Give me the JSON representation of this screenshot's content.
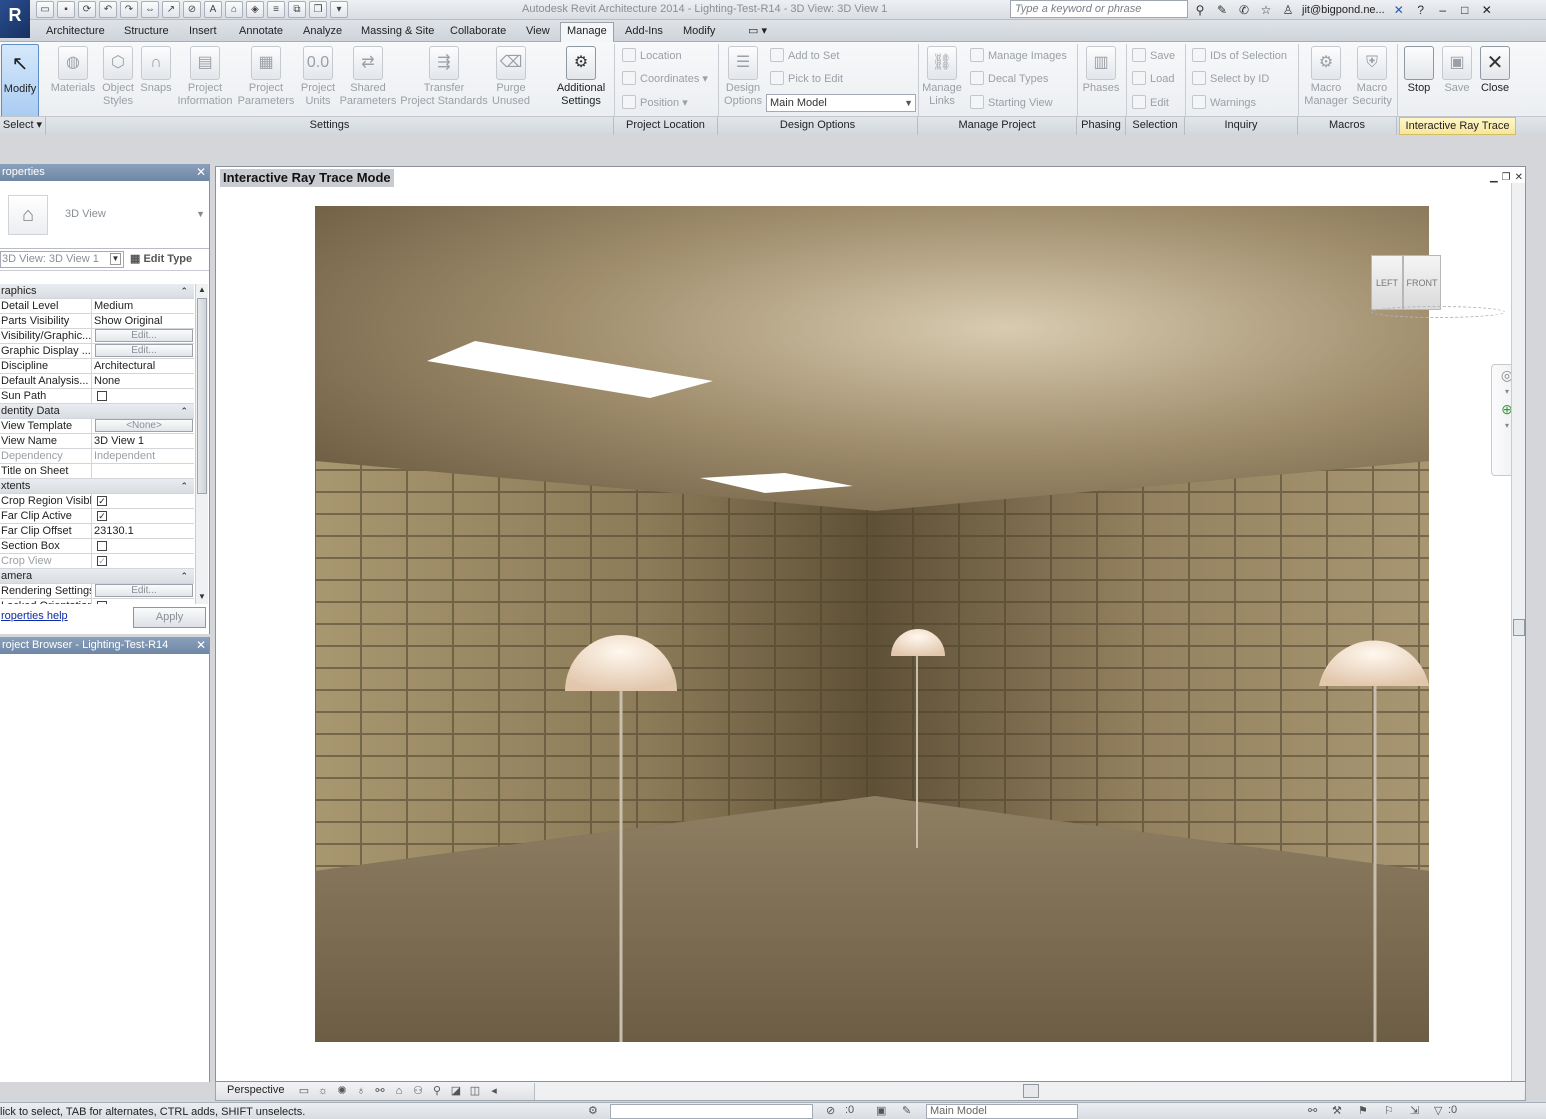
{
  "titlebar": {
    "title": "Autodesk Revit Architecture 2014 -    Lighting-Test-R14 - 3D View: 3D View 1",
    "search_placeholder": "Type a keyword or phrase",
    "user": "jit@bigpond.ne..."
  },
  "tabs": [
    "Architecture",
    "Structure",
    "Insert",
    "Annotate",
    "Analyze",
    "Massing & Site",
    "Collaborate",
    "View",
    "Manage",
    "Add-Ins",
    "Modify"
  ],
  "active_tab": "Manage",
  "ribbon": {
    "modify": "Modify",
    "select": "Select",
    "settings_buttons": [
      {
        "l1": "Materials",
        "l2": ""
      },
      {
        "l1": "Object",
        "l2": "Styles"
      },
      {
        "l1": "Snaps",
        "l2": ""
      },
      {
        "l1": "Project",
        "l2": "Information"
      },
      {
        "l1": "Project",
        "l2": "Parameters"
      },
      {
        "l1": "Project",
        "l2": "Units"
      },
      {
        "l1": "Shared",
        "l2": "Parameters"
      },
      {
        "l1": "Transfer",
        "l2": "Project Standards"
      },
      {
        "l1": "Purge",
        "l2": "Unused"
      }
    ],
    "additional_settings": {
      "l1": "Additional",
      "l2": "Settings"
    },
    "project_location": [
      "Location",
      "Coordinates",
      "Position"
    ],
    "design_options": {
      "l1": "Design",
      "l2": "Options"
    },
    "design_sets": [
      "Add to Set",
      "Pick to Edit"
    ],
    "main_model": "Main Model",
    "manage_links": {
      "l1": "Manage",
      "l2": "Links"
    },
    "manage_project": [
      "Manage  Images",
      "Decal  Types",
      "Starting  View"
    ],
    "phases": "Phases",
    "selection": [
      "Save",
      "Load",
      "Edit"
    ],
    "inquiry": [
      "IDs of  Selection",
      "Select  by ID",
      "Warnings"
    ],
    "macro_manager": {
      "l1": "Macro",
      "l2": "Manager"
    },
    "macro_security": {
      "l1": "Macro",
      "l2": "Security"
    },
    "irt": [
      "Stop",
      "Save",
      "Close"
    ],
    "panel_labels": [
      "Settings",
      "Project Location",
      "Design Options",
      "Manage Project",
      "Phasing",
      "Selection",
      "Inquiry",
      "Macros",
      "Interactive Ray Trace"
    ]
  },
  "properties": {
    "header": "roperties",
    "type_name": "3D View",
    "instance": "3D View: 3D View 1",
    "edit_type": "Edit Type",
    "rows": [
      {
        "group": "raphics"
      },
      {
        "k": "Detail Level",
        "v": "Medium"
      },
      {
        "k": "Parts Visibility",
        "v": "Show Original"
      },
      {
        "k": "Visibility/Graphic...",
        "btn": "Edit..."
      },
      {
        "k": "Graphic Display ...",
        "btn": "Edit..."
      },
      {
        "k": "Discipline",
        "v": "Architectural"
      },
      {
        "k": "Default Analysis...",
        "v": "None"
      },
      {
        "k": "Sun Path",
        "cb": ""
      },
      {
        "group": "dentity Data"
      },
      {
        "k": "View Template",
        "btn": "<None>"
      },
      {
        "k": "View Name",
        "v": "3D View 1"
      },
      {
        "k": "Dependency",
        "v": "Independent",
        "dim": true
      },
      {
        "k": "Title on Sheet",
        "v": ""
      },
      {
        "group": "xtents"
      },
      {
        "k": "Crop Region Visible",
        "cb": "✓"
      },
      {
        "k": "Far Clip Active",
        "cb": "✓"
      },
      {
        "k": "Far Clip Offset",
        "v": "23130.1"
      },
      {
        "k": "Section Box",
        "cb": ""
      },
      {
        "k": "Crop View",
        "cb": "✓",
        "dim": true
      },
      {
        "group": "amera"
      },
      {
        "k": "Rendering Settings",
        "btn": "Edit..."
      },
      {
        "k": "Locked Orientation",
        "cb": ""
      }
    ],
    "help": "roperties help",
    "apply": "Apply"
  },
  "project_browser": {
    "header": "roject Browser - Lighting-Test-R14"
  },
  "view": {
    "title": "Interactive Ray Trace Mode",
    "cube_left": "LEFT",
    "cube_front": "FRONT"
  },
  "view_control": {
    "mode": "Perspective"
  },
  "status": {
    "message": "lick to select, TAB for alternates, CTRL adds, SHIFT unselects.",
    "zero1": ":0",
    "model": "Main Model",
    "zero2": ":0"
  }
}
